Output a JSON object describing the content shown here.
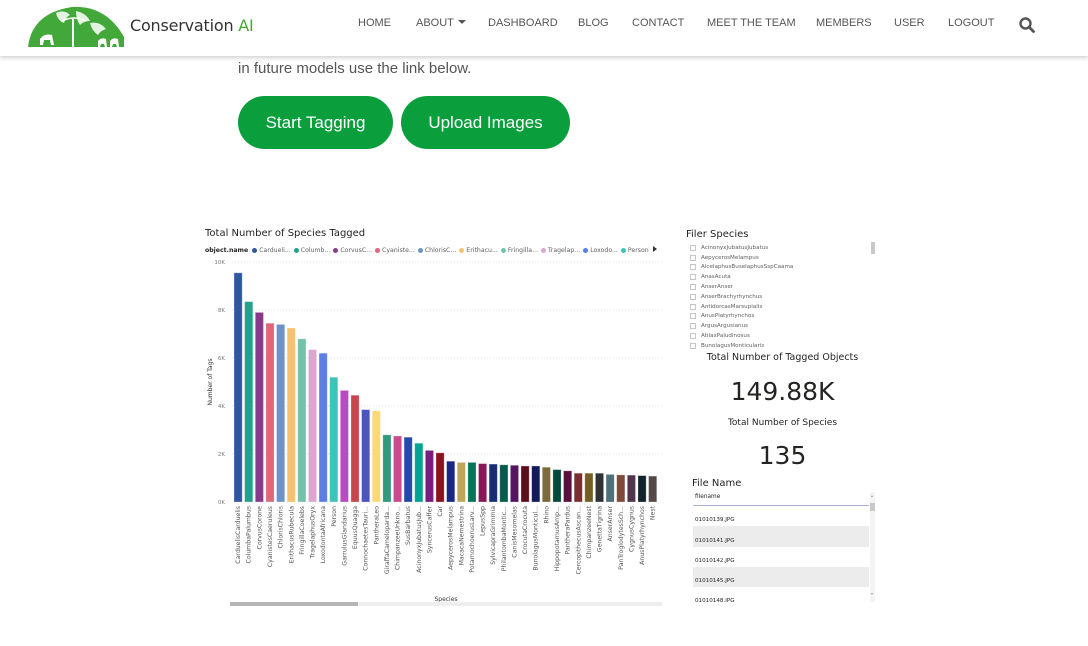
{
  "brand": {
    "name_main": "Conservation ",
    "name_accent": "AI",
    "logo_icon": "globe-wildlife-logo"
  },
  "nav": {
    "items": [
      {
        "label": "HOME"
      },
      {
        "label": "ABOUT",
        "has_dropdown": true
      },
      {
        "label": "DASHBOARD"
      },
      {
        "label": "BLOG"
      },
      {
        "label": "CONTACT"
      },
      {
        "label": "MEET THE TEAM"
      },
      {
        "label": "MEMBERS"
      },
      {
        "label": "USER"
      },
      {
        "label": "LOGOUT"
      }
    ],
    "search_icon": "search-icon"
  },
  "intro": {
    "text": "in future models use the link below."
  },
  "buttons": {
    "start_tagging": "Start Tagging",
    "upload_images": "Upload Images"
  },
  "colors": {
    "brand_green": "#43a83a",
    "button_green": "#0b9e3c"
  },
  "report": {
    "filter": {
      "title": "Filer Species",
      "items": [
        "AcinonyxJubatusJubatus",
        "AepycerosMelampus",
        "AlcelaphusBuselaphusSspCaama",
        "AnasAcuta",
        "AnserAnser",
        "AnserBrachyrhynchus",
        "AntidorcasMarsupialis",
        "AnusPlatyrhynchos",
        "ArgusArgusianus",
        "AtilaxPaludinosus",
        "BunolagusMonticularis"
      ]
    },
    "kpis": {
      "tagged_label": "Total Number of Tagged Objects",
      "tagged_value": "149.88K",
      "species_label": "Total Number of Species",
      "species_value": "135"
    },
    "file_table": {
      "title": "File Name",
      "column": "filename",
      "rows": [
        "01010139.JPG",
        "01010141.JPG",
        "01010142.JPG",
        "01010145.JPG",
        "01010148.JPG"
      ]
    }
  },
  "chart_data": {
    "type": "bar",
    "title": "Total Number of Species Tagged",
    "xlabel": "Species",
    "ylabel": "Number of Tags",
    "ylim": [
      0,
      10000
    ],
    "yticks": [
      0,
      2000,
      4000,
      6000,
      8000,
      10000
    ],
    "ytick_labels": [
      "0K",
      "2K",
      "4K",
      "6K",
      "8K",
      "10K"
    ],
    "grid": true,
    "legend": {
      "title": "object.name",
      "placement": "top-left",
      "entries": [
        {
          "label": "Cardueli...",
          "color": "#2f56a3"
        },
        {
          "label": "Columb...",
          "color": "#21a38b"
        },
        {
          "label": "CorvusC...",
          "color": "#8a3a8a"
        },
        {
          "label": "Cyaniste...",
          "color": "#e0667a"
        },
        {
          "label": "ChlorisC...",
          "color": "#6a93c8"
        },
        {
          "label": "Erithacu...",
          "color": "#f6c271"
        },
        {
          "label": "Fringilla...",
          "color": "#72c3a7"
        },
        {
          "label": "Tragelap...",
          "color": "#dea6cf"
        },
        {
          "label": "Loxodo...",
          "color": "#5a7de6"
        },
        {
          "label": "Person",
          "color": "#3bc4b8"
        }
      ]
    },
    "categories": [
      "CarduelisCarduelis",
      "ColumbaPalumbus",
      "CorvusCorone",
      "CyanistesCaeruleus",
      "ChlorisChloris",
      "ErithacusRubecula",
      "FringillaCoelebs",
      "TragelaphusOryx",
      "LoxodontaAfricana",
      "Person",
      "GarrulusGlandarius",
      "EquusQuagga",
      "ConnochaetesTauri...",
      "PantheraLeo",
      "GiraffaCamelopardа...",
      "ChimpanzeeUnkno...",
      "SusBarbatus",
      "AcinonyxJubatusJub...",
      "SyncerusCaffer",
      "Car",
      "AepycerosMelampus",
      "MacacaNemestrina",
      "PotamochoerusLarv...",
      "LepusSpp",
      "SylvicapraGrimmia",
      "PhilantombaMontic...",
      "CanisMesomelas",
      "CrocutaCrocuta",
      "BunolagusMonticul...",
      "Rhino",
      "HippopotamusAmp...",
      "PantheraPardus",
      "CercopithecusAscan...",
      "ChimpanzeeNest",
      "GenettaTigrina",
      "AnserAnser",
      "PanTroglodytesSch...",
      "CygnusCygnus",
      "AnusPlatyrhynchos",
      "Nest"
    ],
    "values": [
      9550,
      8350,
      7900,
      7450,
      7400,
      7250,
      6800,
      6350,
      6200,
      5200,
      4650,
      4450,
      3850,
      3800,
      2800,
      2750,
      2700,
      2450,
      2150,
      2050,
      1700,
      1650,
      1650,
      1600,
      1580,
      1550,
      1530,
      1500,
      1500,
      1450,
      1350,
      1300,
      1200,
      1200,
      1200,
      1150,
      1130,
      1120,
      1100,
      1080
    ],
    "colors": [
      "#2f56a3",
      "#21a38b",
      "#8a3a8a",
      "#e0667a",
      "#6a93c8",
      "#f6c271",
      "#72c3a7",
      "#dea6cf",
      "#5a7de6",
      "#3bc4b8",
      "#b84cbe",
      "#c9464f",
      "#4a55c2",
      "#fbd97a",
      "#329880",
      "#c94a8e",
      "#2548ac",
      "#02a392",
      "#7c1c80",
      "#8a1321",
      "#1b2784",
      "#bfa55a",
      "#067659",
      "#8a1756",
      "#172f72",
      "#055c4d",
      "#571460",
      "#5b0f1c",
      "#12195c",
      "#7d6b3c",
      "#024a3e",
      "#5a0f3d",
      "#7a2e30",
      "#735f26",
      "#2f3336",
      "#4d6f78",
      "#7e4a39",
      "#52354d",
      "#10252b",
      "#564847"
    ],
    "scrollbar_visible_fraction": 0.3
  }
}
